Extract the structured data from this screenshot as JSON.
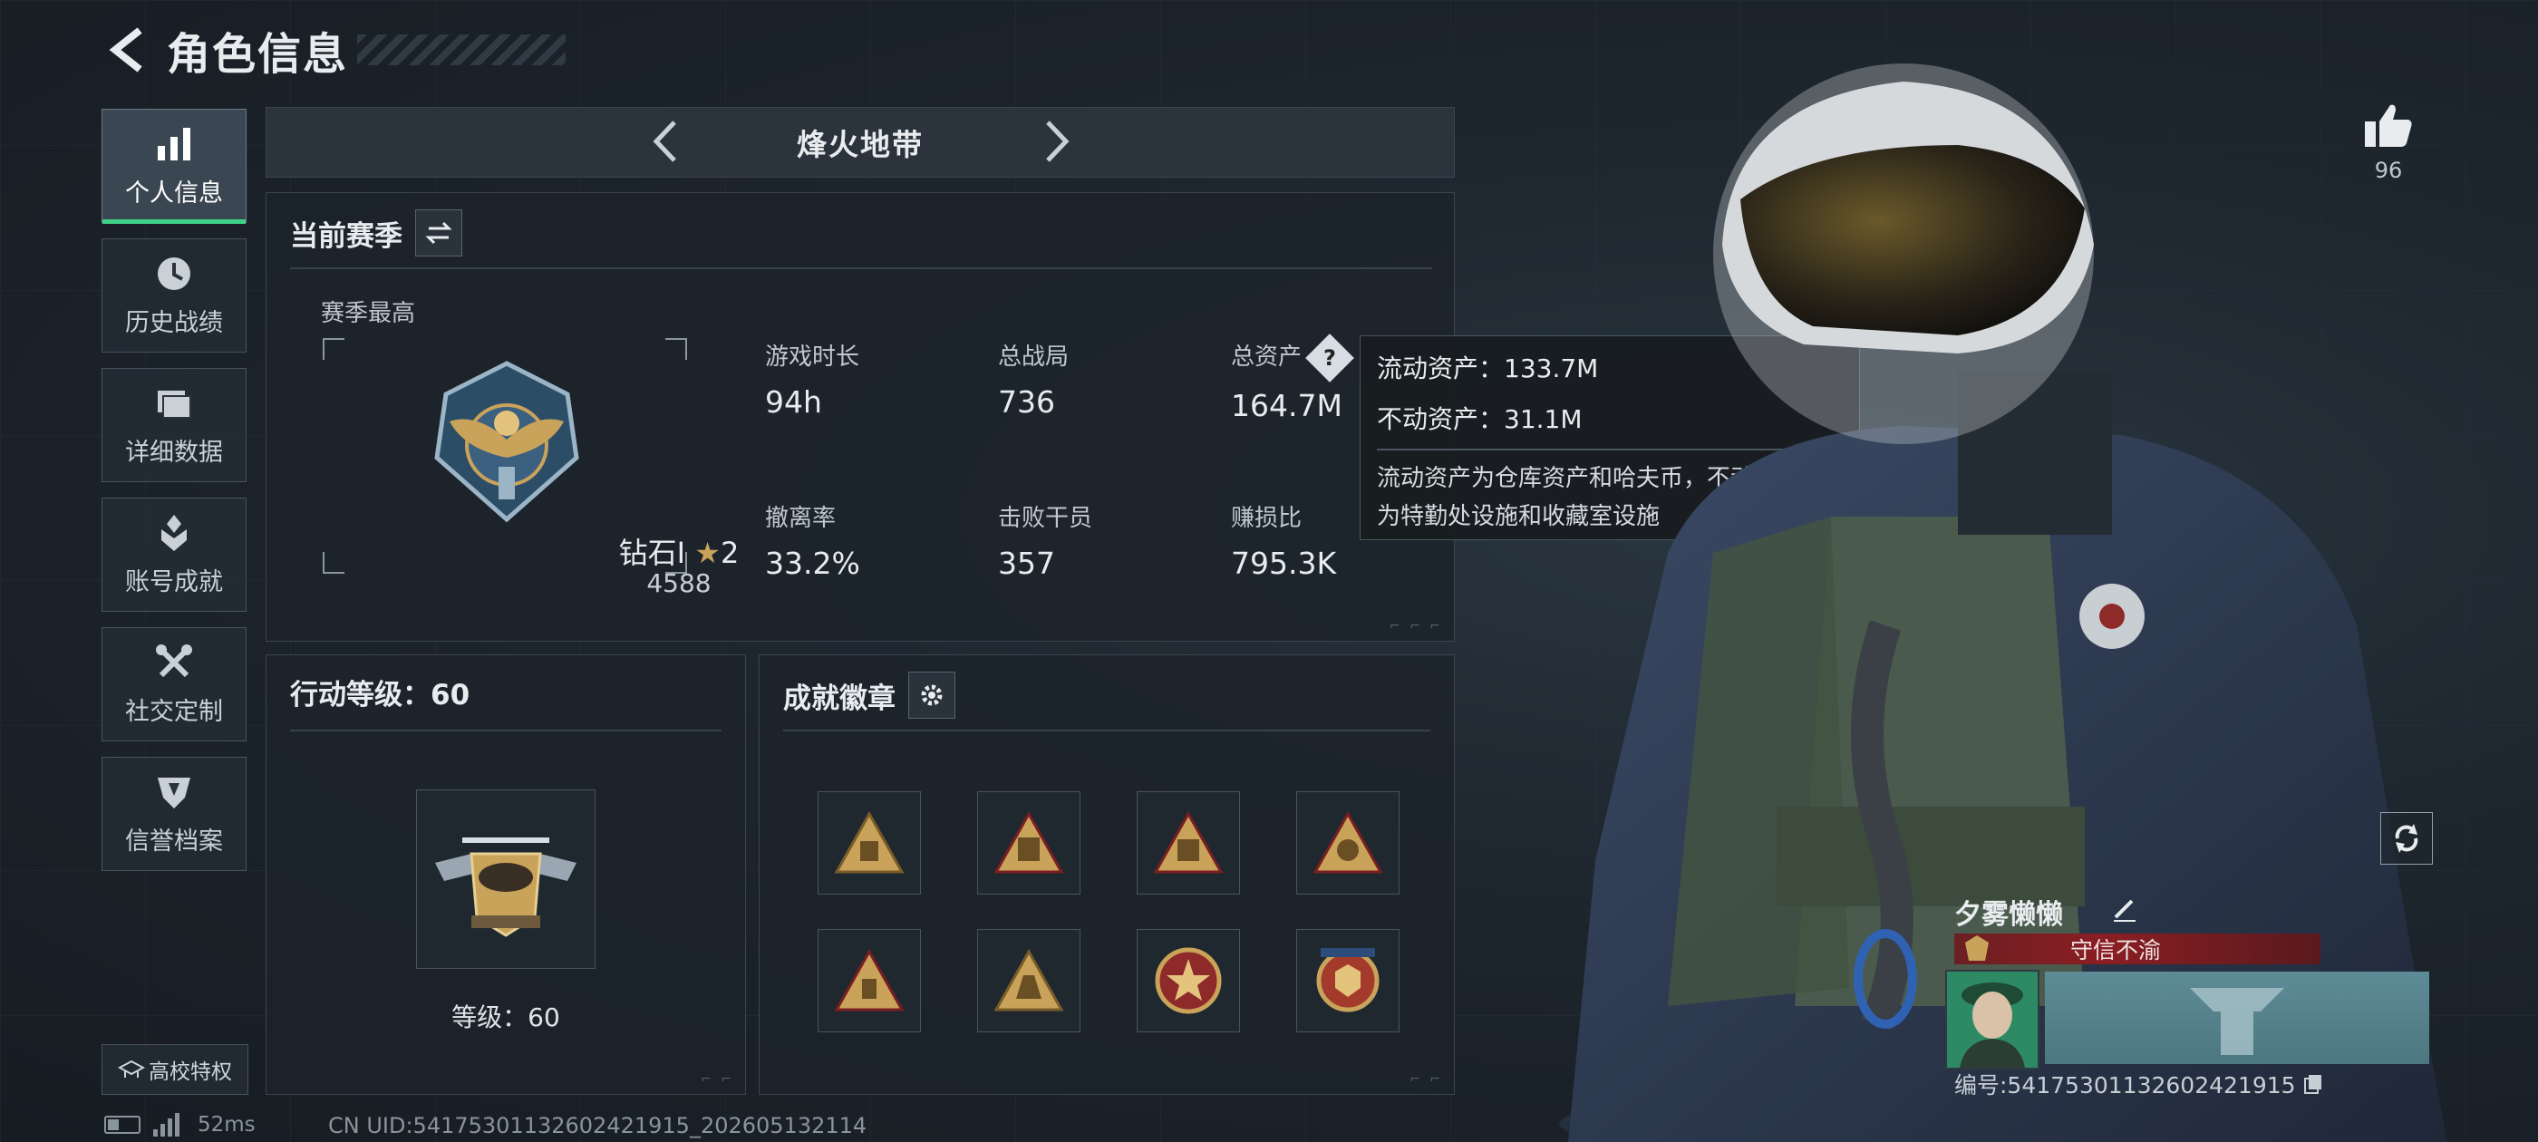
{
  "header": {
    "title": "角色信息"
  },
  "sidebar": {
    "items": [
      {
        "label": "个人信息"
      },
      {
        "label": "历史战绩"
      },
      {
        "label": "详细数据"
      },
      {
        "label": "账号成就"
      },
      {
        "label": "社交定制"
      },
      {
        "label": "信誉档案"
      }
    ],
    "active_index": 0,
    "campus_button": "高校特权"
  },
  "status": {
    "ping": "52ms",
    "uid": "CN UID:54175301132602421915_202605132114"
  },
  "mode": {
    "title": "烽火地带"
  },
  "season": {
    "heading": "当前赛季",
    "best_label": "赛季最高",
    "rank_name": "钻石I",
    "rank_stars": "2",
    "rank_score": "4588",
    "stats": [
      {
        "label": "游戏时长",
        "value": "94h"
      },
      {
        "label": "总战局",
        "value": "736"
      },
      {
        "label": "总资产",
        "value": "164.7M"
      },
      {
        "label": "撤离率",
        "value": "33.2%"
      },
      {
        "label": "击败干员",
        "value": "357"
      },
      {
        "label": "赚损比",
        "value": "795.3K"
      }
    ]
  },
  "tooltip": {
    "liquid": "流动资产：133.7M",
    "fixed": "不动资产：31.1M",
    "desc_line1": "流动资产为仓库资产和哈夫币，不动资产",
    "desc_line2": "为特勤处设施和收藏室设施"
  },
  "level": {
    "heading": "行动等级：60",
    "text": "等级：60"
  },
  "badges": {
    "heading": "成就徽章"
  },
  "profile": {
    "likes": "96",
    "name": "夕雾懒懒",
    "title": "守信不渝",
    "id": "编号:54175301132602421915"
  },
  "colors": {
    "accent": "#3fd08a",
    "title_red": "#8a1e23",
    "gold": "#c9a35a"
  }
}
